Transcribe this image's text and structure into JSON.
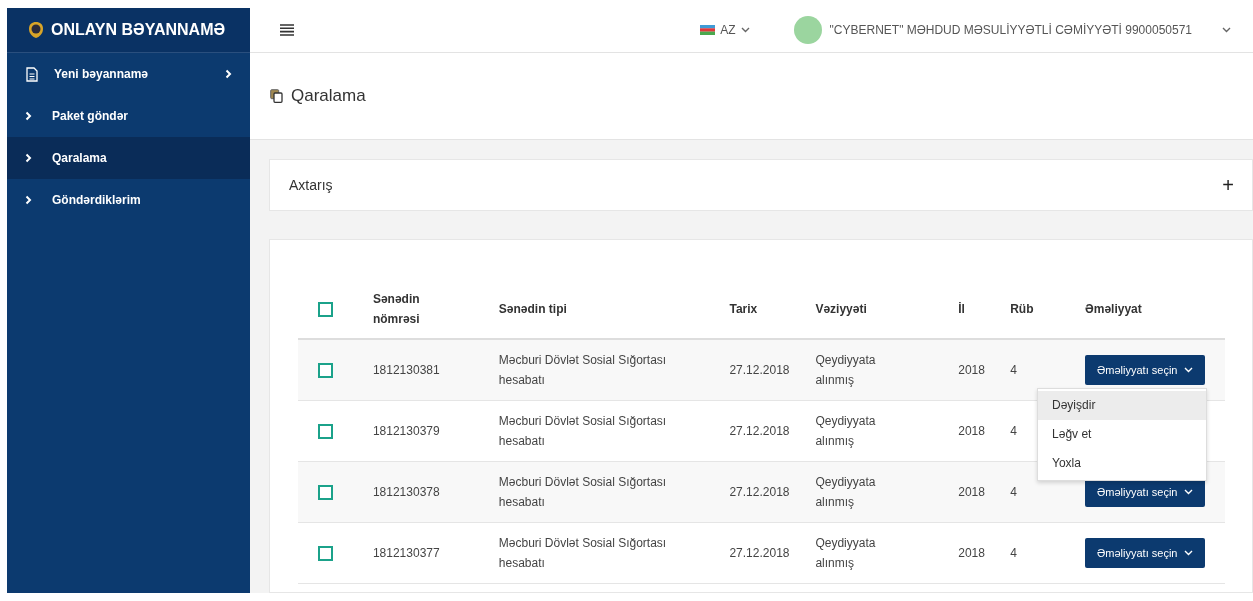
{
  "sidebar": {
    "title": "ONLAYN BƏYANNAMƏ",
    "items": [
      {
        "label": "Yeni bəyannamə",
        "kind": "document",
        "selected": false
      },
      {
        "label": "Paket göndər",
        "kind": "chevron",
        "selected": false
      },
      {
        "label": "Qaralama",
        "kind": "chevron",
        "selected": true
      },
      {
        "label": "Göndərdiklərim",
        "kind": "chevron",
        "selected": false
      }
    ]
  },
  "topbar": {
    "language": "AZ",
    "user": "\"CYBERNET\" MƏHDUD MƏSULİYYƏTLİ CƏMİYYƏTİ 9900050571"
  },
  "page_title": "Qaralama",
  "search_panel": {
    "title": "Axtarış",
    "toggle": "+"
  },
  "table": {
    "columns": [
      "Sənədin nömrəsi",
      "Sənədin tipi",
      "Tarix",
      "Vəziyyəti",
      "İl",
      "Rüb",
      "Əməliyyat"
    ],
    "header_checked": false,
    "rows": [
      {
        "checked": false,
        "number": "1812130381",
        "type": "Məcburi Dövlət Sosial Sığortası hesabatı",
        "date": "27.12.2018",
        "status": "Qeydiyyata alınmış",
        "year": "2018",
        "quarter": "4",
        "action": "Əməliyyatı seçin",
        "menu": [
          {
            "label": "Dəyişdir",
            "highlighted": true
          },
          {
            "label": "Ləğv et",
            "highlighted": false
          },
          {
            "label": "Yoxla",
            "highlighted": false
          }
        ]
      },
      {
        "checked": false,
        "number": "1812130379",
        "type": "Məcburi Dövlət Sosial Sığortası hesabatı",
        "date": "27.12.2018",
        "status": "Qeydiyyata alınmış",
        "year": "2018",
        "quarter": "4"
      },
      {
        "checked": false,
        "number": "1812130378",
        "type": "Məcburi Dövlət Sosial Sığortası hesabatı",
        "date": "27.12.2018",
        "status": "Qeydiyyata alınmış",
        "year": "2018",
        "quarter": "4",
        "action": "Əməliyyatı seçin"
      },
      {
        "checked": false,
        "number": "1812130377",
        "type": "Məcburi Dövlət Sosial Sığortası hesabatı",
        "date": "27.12.2018",
        "status": "Qeydiyyata alınmış",
        "year": "2018",
        "quarter": "4",
        "action": "Əməliyyatı seçin"
      }
    ]
  }
}
